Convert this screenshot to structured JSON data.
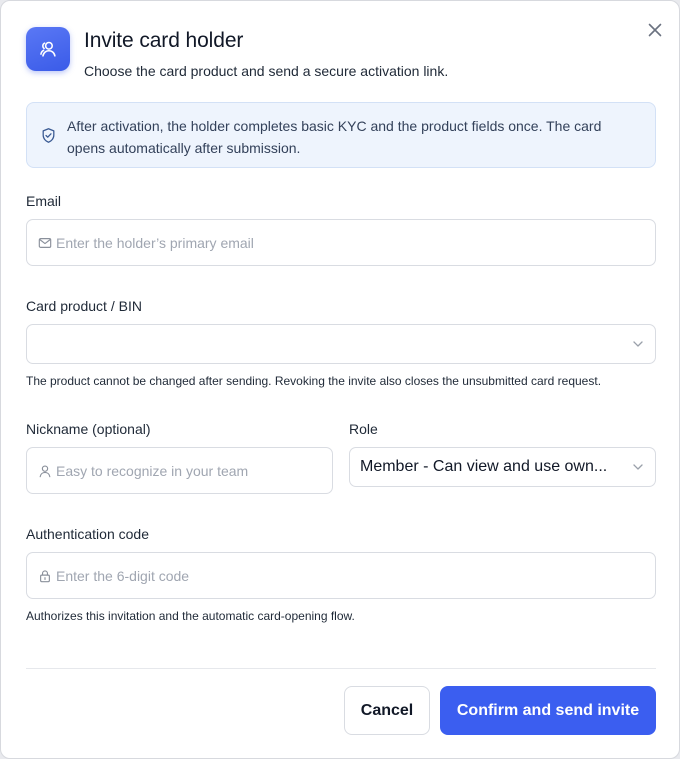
{
  "dialog": {
    "title": "Invite card holder",
    "subtitle": "Choose the card product and send a secure activation link.",
    "header_icon": "users-icon",
    "close_icon": "close-icon"
  },
  "notice": {
    "icon": "shield-check-icon",
    "text": "After activation, the holder completes basic KYC and the product fields once. The card opens automatically after submission."
  },
  "email": {
    "label": "Email",
    "placeholder": "Enter the holder’s primary email",
    "value": "",
    "icon": "mail-icon"
  },
  "card_product": {
    "label": "Card product / BIN",
    "value": "",
    "hint": "The product cannot be changed after sending. Revoking the invite also closes the unsubmitted card request.",
    "icon": "chevron-down-icon"
  },
  "nickname": {
    "label": "Nickname (optional)",
    "placeholder": "Easy to recognize in your team",
    "value": "",
    "icon": "user-icon"
  },
  "role": {
    "label": "Role",
    "value": "Member - Can view and use own...",
    "icon": "chevron-down-icon"
  },
  "auth_code": {
    "label": "Authentication code",
    "placeholder": "Enter the 6-digit code",
    "value": "",
    "hint": "Authorizes this invitation and the automatic card-opening flow.",
    "icon": "lock-icon"
  },
  "actions": {
    "cancel_label": "Cancel",
    "confirm_label": "Confirm and send invite"
  },
  "colors": {
    "primary": "#3b5ef0",
    "notice_bg": "#eef4fd",
    "notice_border": "#d3e1f6"
  }
}
